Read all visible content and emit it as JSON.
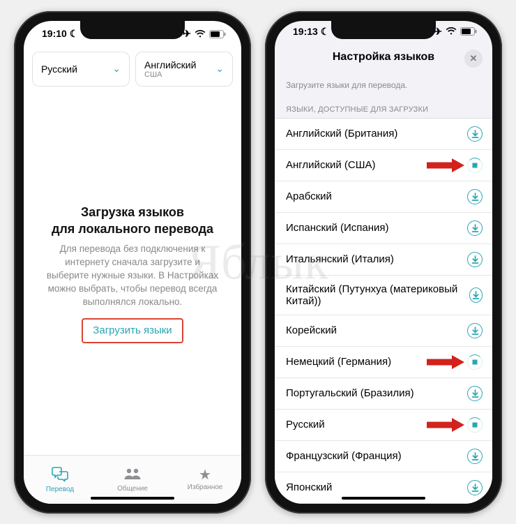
{
  "watermark": "Яблык",
  "colors": {
    "accent": "#2aa5b3",
    "highlight_border": "#d94530"
  },
  "left": {
    "status": {
      "time": "19:10"
    },
    "picker": {
      "source": {
        "label": "Русский",
        "sub": ""
      },
      "target": {
        "label": "Английский",
        "sub": "США"
      }
    },
    "empty": {
      "title_line1": "Загрузка языков",
      "title_line2": "для локального перевода",
      "desc": "Для перевода без подключения к интернету сначала загрузите и выберите нужные языки. В Настройках можно выбрать, чтобы перевод всегда выполнялся локально.",
      "button": "Загрузить языки"
    },
    "tabs": {
      "translate": "Перевод",
      "chat": "Общение",
      "favorites": "Избранное"
    }
  },
  "right": {
    "status": {
      "time": "19:13"
    },
    "sheet": {
      "title": "Настройка языков",
      "helper": "Загрузите языки для перевода.",
      "section": "ЯЗЫКИ, ДОСТУПНЫЕ ДЛЯ ЗАГРУЗКИ",
      "languages": [
        {
          "name": "Английский (Британия)",
          "state": "download",
          "arrow": false
        },
        {
          "name": "Английский (США)",
          "state": "loading",
          "arrow": true
        },
        {
          "name": "Арабский",
          "state": "download",
          "arrow": false
        },
        {
          "name": "Испанский (Испания)",
          "state": "download",
          "arrow": false
        },
        {
          "name": "Итальянский (Италия)",
          "state": "download",
          "arrow": false
        },
        {
          "name": "Китайский (Путунхуа (материковый Китай))",
          "state": "download",
          "arrow": false
        },
        {
          "name": "Корейский",
          "state": "download",
          "arrow": false
        },
        {
          "name": "Немецкий (Германия)",
          "state": "loading",
          "arrow": true
        },
        {
          "name": "Португальский (Бразилия)",
          "state": "download",
          "arrow": false
        },
        {
          "name": "Русский",
          "state": "loading",
          "arrow": true
        },
        {
          "name": "Французский (Франция)",
          "state": "download",
          "arrow": false
        },
        {
          "name": "Японский",
          "state": "download",
          "arrow": false
        }
      ]
    }
  }
}
